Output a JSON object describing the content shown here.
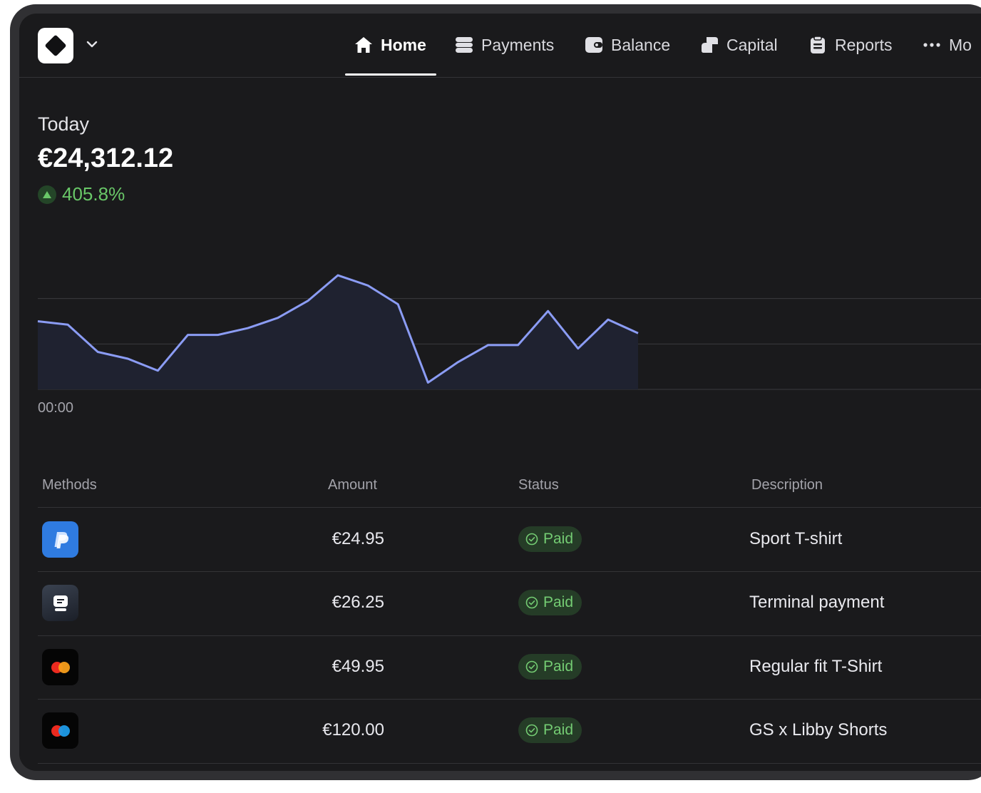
{
  "nav": {
    "items": [
      {
        "label": "Home",
        "icon": "home-icon",
        "active": true
      },
      {
        "label": "Payments",
        "icon": "payments-icon"
      },
      {
        "label": "Balance",
        "icon": "balance-icon"
      },
      {
        "label": "Capital",
        "icon": "capital-icon"
      },
      {
        "label": "Reports",
        "icon": "reports-icon"
      },
      {
        "label": "Mo",
        "icon": "more-icon"
      }
    ]
  },
  "summary": {
    "label": "Today",
    "amount": "€24,312.12",
    "change": "405.8%"
  },
  "chart_data": {
    "type": "area",
    "xlabel": "",
    "ylabel": "",
    "x_tick_labels": [
      "00:00"
    ],
    "series": [
      {
        "values": [
          60,
          58,
          42,
          38,
          31,
          52,
          52,
          56,
          62,
          72,
          87,
          81,
          70,
          24,
          36,
          46,
          46,
          66,
          44,
          61,
          53
        ]
      }
    ],
    "ylim": [
      20,
      100
    ],
    "grid": true,
    "line_color": "#8b9cf4",
    "fill_color": "#1f2230"
  },
  "table": {
    "headers": [
      "Methods",
      "Amount",
      "Status",
      "Description"
    ],
    "rows": [
      {
        "method": "paypal-icon",
        "amount": "€24.95",
        "status": "Paid",
        "description": "Sport T-shirt"
      },
      {
        "method": "terminal-icon",
        "amount": "€26.25",
        "status": "Paid",
        "description": "Terminal payment"
      },
      {
        "method": "mastercard-icon",
        "amount": "€49.95",
        "status": "Paid",
        "description": "Regular fit T-Shirt"
      },
      {
        "method": "maestro-icon",
        "amount": "€120.00",
        "status": "Paid",
        "description": "GS x Libby Shorts"
      }
    ]
  },
  "colors": {
    "background": "#1a1a1c",
    "accent_positive": "#69c768",
    "chart_line": "#8b9cf4"
  }
}
